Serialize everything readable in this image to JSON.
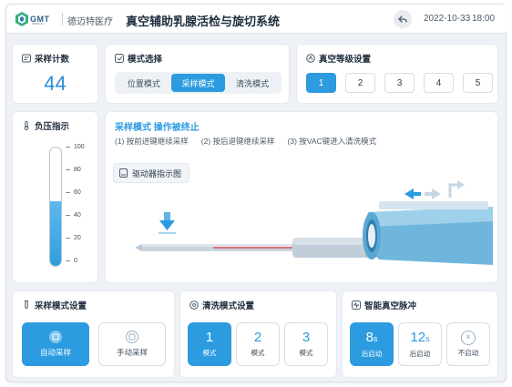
{
  "header": {
    "logo_text": "GMT",
    "logo_sub": "MEDICAL",
    "org": "德迈特医疗",
    "title": "真空辅助乳腺活检与旋切系统",
    "date": "2022-10-33",
    "time": "18:00",
    "back_icon": "back-arrow-icon"
  },
  "sample_count": {
    "title": "采样计数",
    "value": "44"
  },
  "mode_select": {
    "title": "模式选择",
    "options": [
      "位置模式",
      "采样模式",
      "清洗模式"
    ],
    "active_index": 1
  },
  "vacuum_level": {
    "title": "真空等级设置",
    "levels": [
      "1",
      "2",
      "3",
      "4",
      "5"
    ],
    "active_index": 0
  },
  "pressure": {
    "title": "负压指示",
    "ticks": [
      "100",
      "80",
      "60",
      "40",
      "20",
      "0"
    ],
    "fill_percent": 55
  },
  "status": {
    "title": "采样模式  操作被终止",
    "hints": [
      "(1) 按前进键继续采样",
      "(2) 按后退键继续采样",
      "(3) 按VAC键进入清洗模式"
    ],
    "driver_label": "驱动器指示图"
  },
  "sample_setting": {
    "title": "采样模式设置",
    "buttons": [
      "自动采样",
      "手动采样"
    ],
    "active_index": 0
  },
  "wash_setting": {
    "title": "清洗模式设置",
    "buttons": [
      {
        "num": "1",
        "label": "模式"
      },
      {
        "num": "2",
        "label": "模式"
      },
      {
        "num": "3",
        "label": "模式"
      }
    ],
    "active_index": 0
  },
  "pulse": {
    "title": "智能真空脉冲",
    "buttons": [
      {
        "num": "8",
        "unit": "s",
        "label": "后启动"
      },
      {
        "num": "12",
        "unit": "s",
        "label": "后启动"
      },
      {
        "num": "",
        "unit": "",
        "label": "不启动"
      }
    ],
    "active_index": 0
  },
  "colors": {
    "accent": "#2c9be0",
    "background": "#eef1f5",
    "needle_line": "#e0535a"
  }
}
